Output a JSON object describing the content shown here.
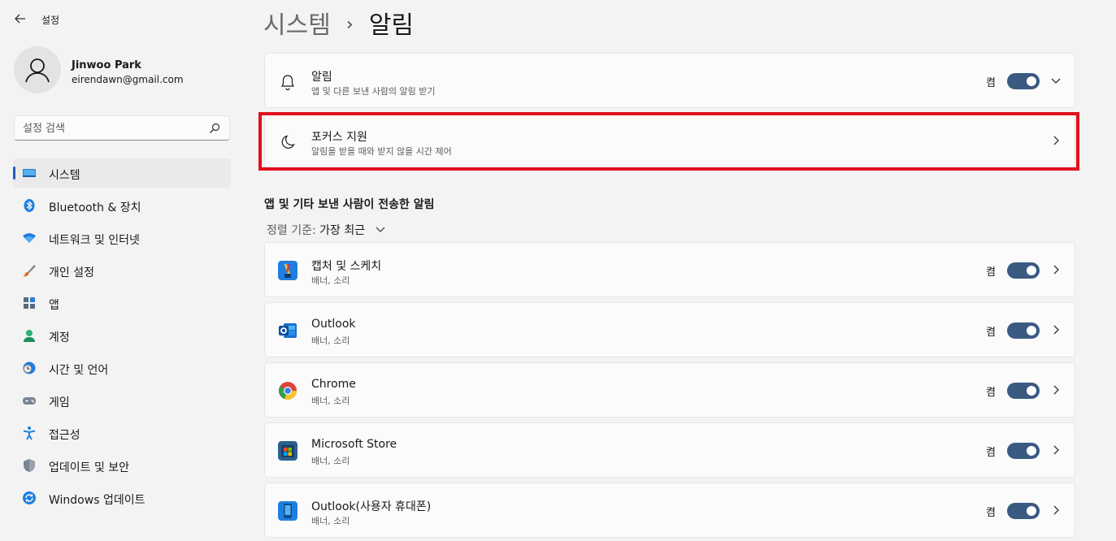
{
  "app": {
    "title": "설정",
    "back_icon": "back-arrow-icon"
  },
  "profile": {
    "name": "Jinwoo Park",
    "email": "eirendawn@gmail.com"
  },
  "search": {
    "placeholder": "설정 검색"
  },
  "sidebar": {
    "items": [
      {
        "label": "시스템",
        "icon": "system-icon",
        "active": true
      },
      {
        "label": "Bluetooth & 장치",
        "icon": "bluetooth-icon"
      },
      {
        "label": "네트워크 및 인터넷",
        "icon": "wifi-icon"
      },
      {
        "label": "개인 설정",
        "icon": "brush-icon"
      },
      {
        "label": "앱",
        "icon": "apps-icon"
      },
      {
        "label": "계정",
        "icon": "account-icon"
      },
      {
        "label": "시간 및 언어",
        "icon": "time-language-icon"
      },
      {
        "label": "게임",
        "icon": "gaming-icon"
      },
      {
        "label": "접근성",
        "icon": "accessibility-icon"
      },
      {
        "label": "업데이트 및 보안",
        "icon": "shield-icon"
      },
      {
        "label": "Windows 업데이트",
        "icon": "windows-update-icon"
      }
    ]
  },
  "breadcrumb": {
    "parent": "시스템",
    "separator": "›",
    "current": "알림"
  },
  "cards": {
    "notifications": {
      "title": "알림",
      "subtitle": "앱 및 다른 보낸 사람의 알림 받기",
      "toggle_label": "켬",
      "icon": "bell-icon",
      "on": true
    },
    "focus": {
      "title": "포커스 지원",
      "subtitle": "알림을 받을 때와 받지 않을 시간 제어",
      "icon": "moon-icon"
    }
  },
  "section": {
    "title": "앱 및 기타 보낸 사람이 전송한 알림",
    "sort_label": "정렬 기준:",
    "sort_value": "가장 최근"
  },
  "apps": [
    {
      "name": "캡처 및 스케치",
      "detail": "배너, 소리",
      "toggle_label": "켬",
      "on": true,
      "icon": "snip-sketch-icon"
    },
    {
      "name": "Outlook",
      "detail": "배너, 소리",
      "toggle_label": "켬",
      "on": true,
      "icon": "outlook-icon"
    },
    {
      "name": "Chrome",
      "detail": "배너, 소리",
      "toggle_label": "켬",
      "on": true,
      "icon": "chrome-icon"
    },
    {
      "name": "Microsoft Store",
      "detail": "배너, 소리",
      "toggle_label": "켬",
      "on": true,
      "icon": "microsoft-store-icon"
    },
    {
      "name": "Outlook(사용자 휴대폰)",
      "detail": "배너, 소리",
      "toggle_label": "켬",
      "on": true,
      "icon": "phone-icon"
    }
  ],
  "colors": {
    "accent": "#1d5fbf",
    "toggle_on": "#3a5a82",
    "highlight_border": "#e0111d"
  }
}
